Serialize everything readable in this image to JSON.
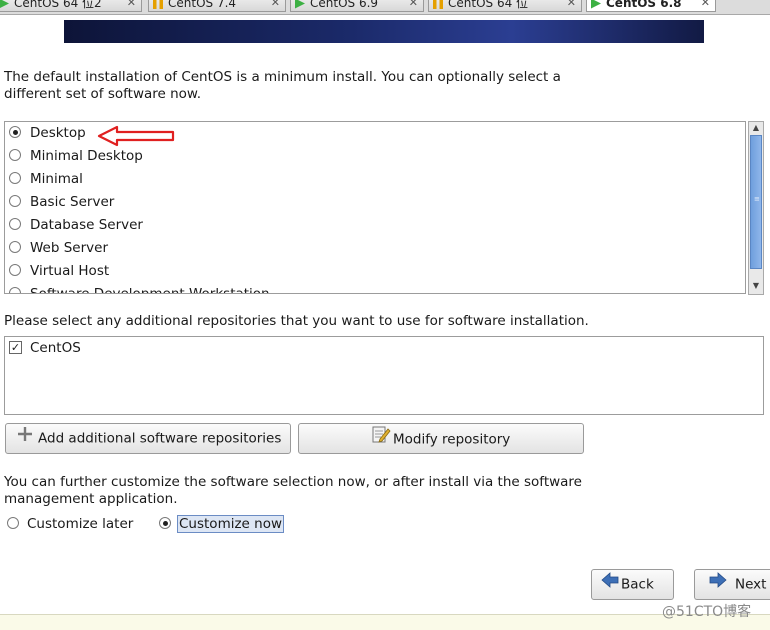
{
  "tabs": [
    {
      "label": "CentOS 64 位2",
      "icon": "vm-running-icon"
    },
    {
      "label": "CentOS 7.4",
      "icon": "vm-paused-icon"
    },
    {
      "label": "CentOS 6.9",
      "icon": "vm-running-icon"
    },
    {
      "label": "CentOS 64 位",
      "icon": "vm-paused-icon"
    },
    {
      "label": "CentOS 6.8",
      "icon": "vm-running-icon"
    }
  ],
  "intro": {
    "line1": "The default installation of CentOS is a minimum install. You can optionally select a",
    "line2": "different set of software now."
  },
  "software_sets": [
    {
      "label": "Desktop",
      "selected": true
    },
    {
      "label": "Minimal Desktop",
      "selected": false
    },
    {
      "label": "Minimal",
      "selected": false
    },
    {
      "label": "Basic Server",
      "selected": false
    },
    {
      "label": "Database Server",
      "selected": false
    },
    {
      "label": "Web Server",
      "selected": false
    },
    {
      "label": "Virtual Host",
      "selected": false
    },
    {
      "label": "Software Development Workstation",
      "selected": false
    }
  ],
  "annotation": {
    "color": "#e02020",
    "icon": "red-arrow-annotation"
  },
  "repos": {
    "prompt": "Please select any additional repositories that you want to use for software installation.",
    "items": [
      {
        "label": "CentOS",
        "checked": true
      }
    ]
  },
  "buttons": {
    "add_repo": "Add additional software repositories",
    "modify_repo": "Modify repository",
    "back": "Back",
    "next": "Next"
  },
  "customize": {
    "line1": "You can further customize the software selection now, or after install via the software",
    "line2": "management application.",
    "later": "Customize later",
    "now": "Customize now",
    "selected": "now"
  },
  "watermark": "@51CTO博客"
}
